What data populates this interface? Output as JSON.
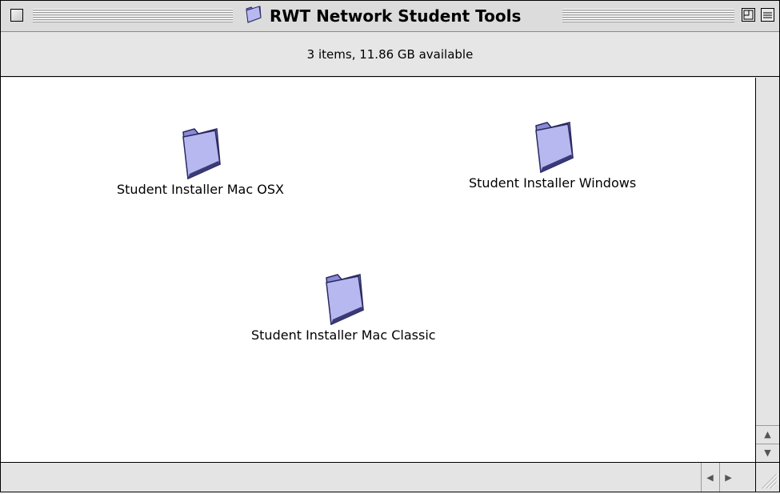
{
  "window": {
    "title": "RWT Network Student Tools",
    "folder_icon": "folder-icon"
  },
  "info_bar": {
    "text": "3 items, 11.86 GB available"
  },
  "items": [
    {
      "label": "Student Installer Mac OSX",
      "icon": "folder-icon"
    },
    {
      "label": "Student Installer Windows",
      "icon": "folder-icon"
    },
    {
      "label": "Student Installer Mac Classic",
      "icon": "folder-icon"
    }
  ],
  "colors": {
    "folder_light": "#b8b8f0",
    "folder_dark": "#6a6ac8",
    "folder_shadow": "#3a3a78"
  }
}
